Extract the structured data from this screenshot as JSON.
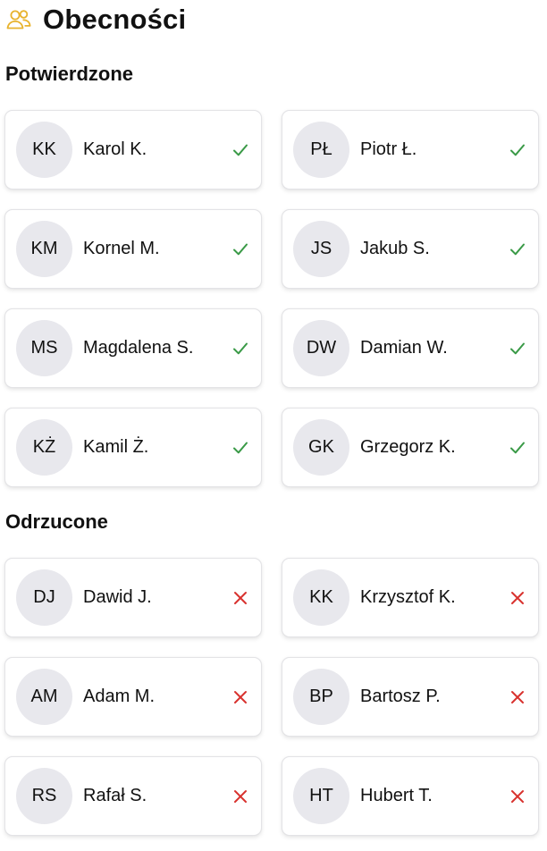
{
  "header": {
    "title": "Obecności",
    "icon": "people-icon",
    "icon_color": "#e8b32e"
  },
  "colors": {
    "confirmed": "#3a9a47",
    "rejected": "#d8322e"
  },
  "sections": [
    {
      "key": "confirmed",
      "title": "Potwierdzone",
      "status_icon": "check-icon",
      "people": [
        {
          "initials": "KK",
          "name": "Karol K."
        },
        {
          "initials": "PŁ",
          "name": "Piotr Ł."
        },
        {
          "initials": "KM",
          "name": "Kornel M."
        },
        {
          "initials": "JS",
          "name": "Jakub S."
        },
        {
          "initials": "MS",
          "name": "Magdalena S."
        },
        {
          "initials": "DW",
          "name": "Damian W."
        },
        {
          "initials": "KŻ",
          "name": "Kamil Ż."
        },
        {
          "initials": "GK",
          "name": "Grzegorz K."
        }
      ]
    },
    {
      "key": "rejected",
      "title": "Odrzucone",
      "status_icon": "cross-icon",
      "people": [
        {
          "initials": "DJ",
          "name": "Dawid J."
        },
        {
          "initials": "KK",
          "name": "Krzysztof K."
        },
        {
          "initials": "AM",
          "name": "Adam M."
        },
        {
          "initials": "BP",
          "name": "Bartosz P."
        },
        {
          "initials": "RS",
          "name": "Rafał S."
        },
        {
          "initials": "HT",
          "name": "Hubert T."
        }
      ]
    }
  ]
}
